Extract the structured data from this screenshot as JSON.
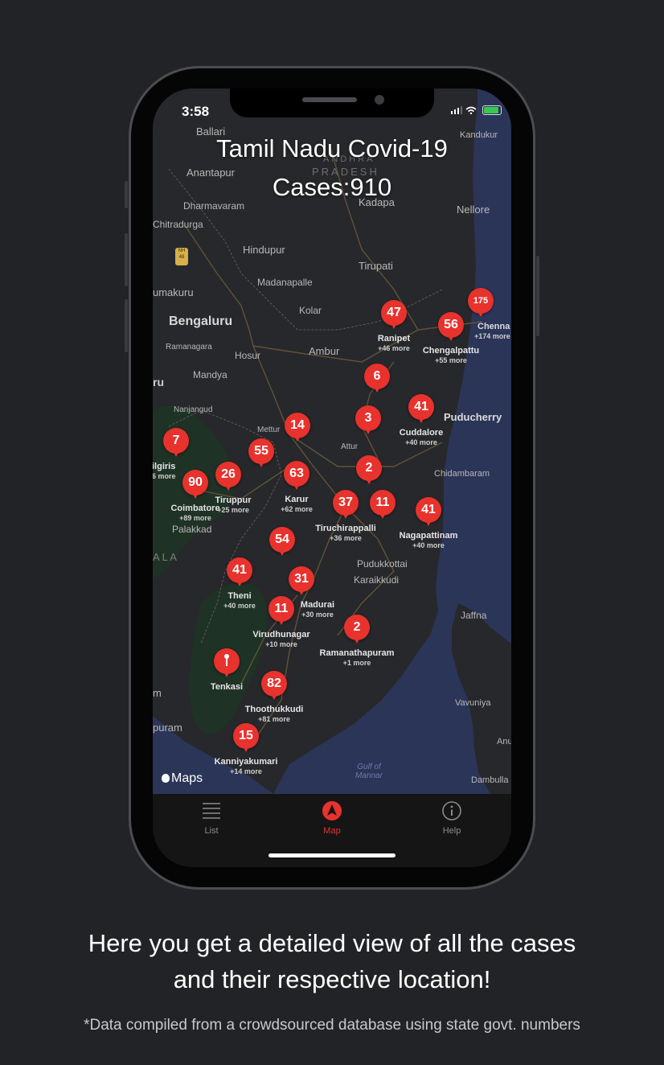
{
  "status_bar": {
    "time": "3:58"
  },
  "map": {
    "title_line1": "Tamil Nadu Covid-19",
    "title_line2": "Cases:910",
    "places": [
      {
        "id": "ballari",
        "text": "Ballari"
      },
      {
        "id": "kandukur",
        "text": "Kandukur"
      },
      {
        "id": "andhra",
        "text": "ANDHRA"
      },
      {
        "id": "pradesh",
        "text": "PRADESH"
      },
      {
        "id": "anantapur",
        "text": "Anantapur"
      },
      {
        "id": "kadapa",
        "text": "Kadapa"
      },
      {
        "id": "dharmavaram",
        "text": "Dharmavaram"
      },
      {
        "id": "nellore",
        "text": "Nellore"
      },
      {
        "id": "chitradurga",
        "text": "Chitradurga"
      },
      {
        "id": "nh48",
        "text": "NH 48"
      },
      {
        "id": "hindupur",
        "text": "Hindupur"
      },
      {
        "id": "tirupati",
        "text": "Tirupati"
      },
      {
        "id": "madanapalle",
        "text": "Madanapalle"
      },
      {
        "id": "tumakuru",
        "text": "umakuru"
      },
      {
        "id": "kolar",
        "text": "Kolar"
      },
      {
        "id": "bengaluru",
        "text": "Bengaluru"
      },
      {
        "id": "chennai",
        "text": "Chenna"
      },
      {
        "id": "ramanagara",
        "text": "Ramanagara"
      },
      {
        "id": "hosur",
        "text": "Hosur"
      },
      {
        "id": "ambur",
        "text": "Ambur"
      },
      {
        "id": "mandya",
        "text": "Mandya"
      },
      {
        "id": "ru",
        "text": "ru"
      },
      {
        "id": "nanjangud",
        "text": "Nanjangud"
      },
      {
        "id": "mettur",
        "text": "Mettur"
      },
      {
        "id": "puducherry",
        "text": "Puducherry"
      },
      {
        "id": "attur",
        "text": "Attur"
      },
      {
        "id": "chidambaram",
        "text": "Chidambaram"
      },
      {
        "id": "palakkad",
        "text": "Palakkad"
      },
      {
        "id": "ala",
        "text": "A L A"
      },
      {
        "id": "pudukkottai",
        "text": "Pudukkottai"
      },
      {
        "id": "karaikkudi",
        "text": "Karaikkudi"
      },
      {
        "id": "jaffna",
        "text": "Jaffna"
      },
      {
        "id": "vavuniya",
        "text": "Vavuniya"
      },
      {
        "id": "m",
        "text": "m"
      },
      {
        "id": "puram",
        "text": "puram"
      },
      {
        "id": "anu",
        "text": "Anu"
      },
      {
        "id": "gulf",
        "text": "Gulf of Mannar"
      },
      {
        "id": "dambulla",
        "text": "Dambulla"
      }
    ],
    "clusters": [
      {
        "count": "175",
        "label": "Chenna",
        "more": "+174 more"
      },
      {
        "count": "47",
        "label": "Ranipet",
        "more": "+46 more"
      },
      {
        "count": "56",
        "label": "Chengalpattu",
        "more": "+55 more"
      },
      {
        "count": "6",
        "label": "",
        "more": ""
      },
      {
        "count": "41",
        "label": "Cuddalore",
        "more": "+40 more"
      },
      {
        "count": "3",
        "label": "",
        "more": ""
      },
      {
        "count": "14",
        "label": "",
        "more": ""
      },
      {
        "count": "7",
        "label": "ilgiris",
        "more": "6 more"
      },
      {
        "count": "55",
        "label": "",
        "more": ""
      },
      {
        "count": "26",
        "label": "Tiruppur",
        "more": "+25 more"
      },
      {
        "count": "63",
        "label": "Karur",
        "more": "+62 more"
      },
      {
        "count": "2",
        "label": "",
        "more": ""
      },
      {
        "count": "90",
        "label": "Coimbatore",
        "more": "+89 more"
      },
      {
        "count": "37",
        "label": "Tiruchirappalli",
        "more": "+36 more"
      },
      {
        "count": "11",
        "label": "",
        "more": ""
      },
      {
        "count": "41",
        "label": "Nagapattinam",
        "more": "+40 more"
      },
      {
        "count": "54",
        "label": "",
        "more": ""
      },
      {
        "count": "41",
        "label": "Theni",
        "more": "+40 more"
      },
      {
        "count": "31",
        "label": "Madurai",
        "more": "+30 more"
      },
      {
        "count": "11",
        "label": "Virudhunagar",
        "more": "+10 more"
      },
      {
        "count": "2",
        "label": "Ramanathapuram",
        "more": "+1 more"
      },
      {
        "count": "",
        "label": "Tenkasi",
        "more": ""
      },
      {
        "count": "82",
        "label": "Thoothukkudi",
        "more": "+81 more"
      },
      {
        "count": "15",
        "label": "Kanniyakumari",
        "more": "+14 more"
      }
    ],
    "maps_logo": "Maps"
  },
  "tabs": [
    {
      "label": "List",
      "icon": "list-icon",
      "active": false
    },
    {
      "label": "Map",
      "icon": "navigation-arrow-icon",
      "active": true
    },
    {
      "label": "Help",
      "icon": "info-icon",
      "active": false
    }
  ],
  "caption_line1": "Here you get a detailed view of all the cases",
  "caption_line2": "and their respective location!",
  "footnote": "*Data compiled from a crowdsourced database using state govt. numbers",
  "colors": {
    "background": "#222326",
    "pin": "#e8322d",
    "sea": "#2b3558",
    "land": "#27282b"
  }
}
